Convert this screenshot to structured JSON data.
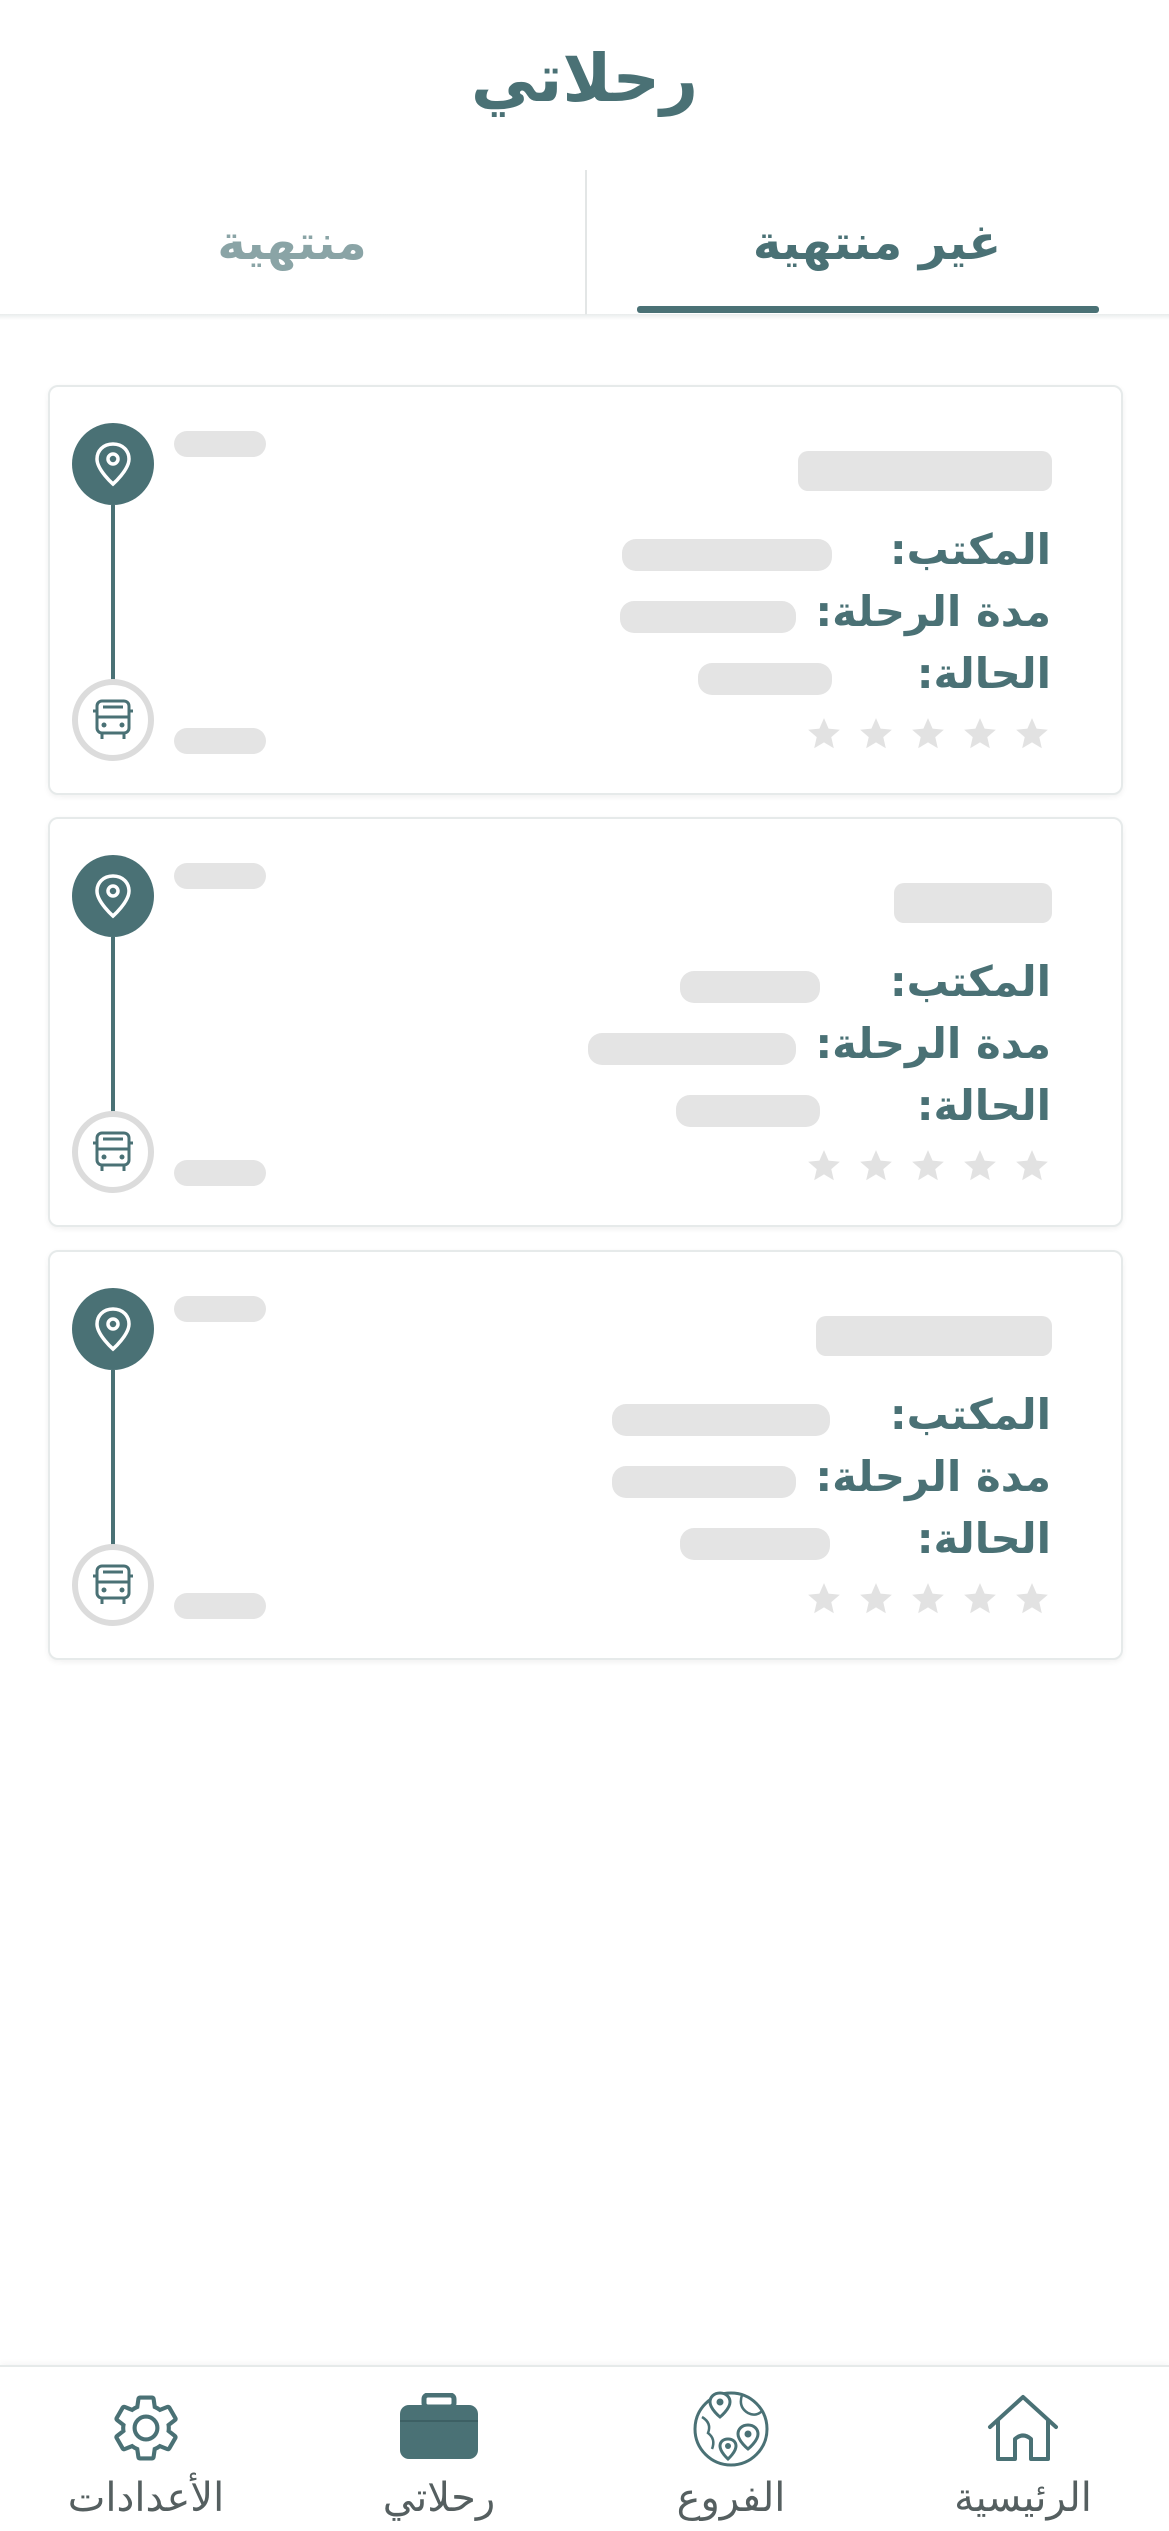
{
  "header": {
    "title": "رحلاتي"
  },
  "tabs": [
    {
      "label": "غير منتهية",
      "active": true
    },
    {
      "label": "منتهية",
      "active": false
    }
  ],
  "trip_card": {
    "office_label": "المكتب:",
    "duration_label": "مدة الرحلة:",
    "status_label": "الحالة:",
    "rating_stars": 5,
    "loading": true
  },
  "cards_count": 3,
  "bottom_nav": {
    "items": [
      {
        "label": "الرئيسية",
        "icon": "home-icon"
      },
      {
        "label": "الفروع",
        "icon": "globe-pins-icon"
      },
      {
        "label": "رحلاتي",
        "icon": "suitcase-icon",
        "active": true
      },
      {
        "label": "الأعدادات",
        "icon": "gear-icon"
      }
    ]
  },
  "colors": {
    "accent": "#4a7175",
    "tab_inactive": "#8aa4a6",
    "skeleton": "#e4e4e4",
    "star": "#e2e2e2",
    "nav_text": "#555f60"
  }
}
